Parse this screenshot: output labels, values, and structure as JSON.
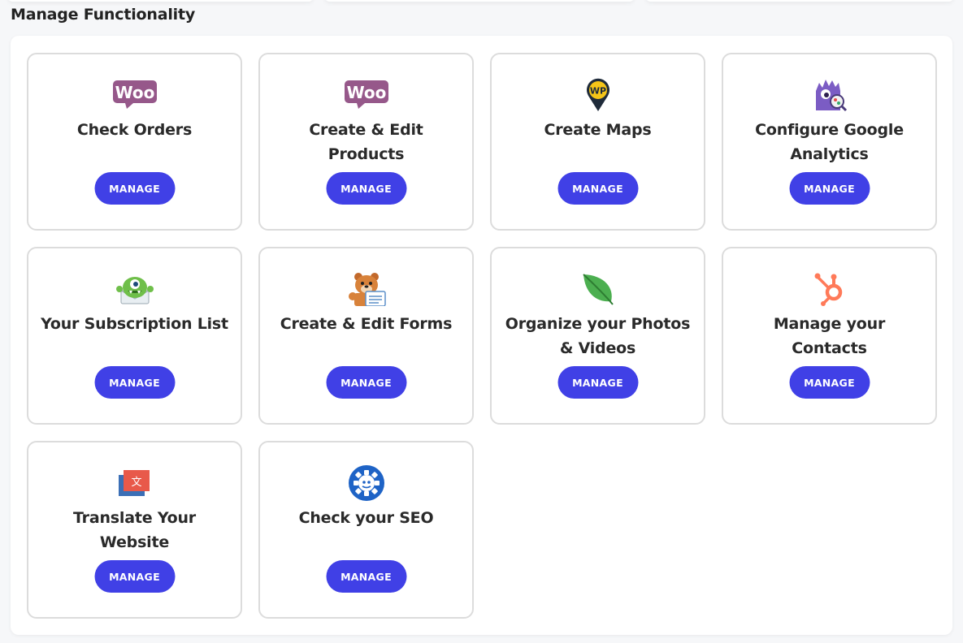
{
  "section": {
    "title": "Manage Functionality"
  },
  "colors": {
    "button": "#4040e6",
    "card_border": "#dcdcdc"
  },
  "cards": [
    {
      "title": "Check Orders",
      "icon": "woocommerce-icon",
      "button": "MANAGE"
    },
    {
      "title": "Create & Edit Products",
      "icon": "woocommerce-icon",
      "button": "MANAGE"
    },
    {
      "title": "Create Maps",
      "icon": "wp-map-pin-icon",
      "button": "MANAGE"
    },
    {
      "title": "Configure Google Analytics",
      "icon": "monsterinsights-icon",
      "button": "MANAGE"
    },
    {
      "title": "Your Subscription List",
      "icon": "optinmonster-icon",
      "button": "MANAGE"
    },
    {
      "title": "Create & Edit Forms",
      "icon": "wpforms-bear-icon",
      "button": "MANAGE"
    },
    {
      "title": "Organize your Photos & Videos",
      "icon": "leaf-icon",
      "button": "MANAGE"
    },
    {
      "title": "Manage your Contacts",
      "icon": "hubspot-icon",
      "button": "MANAGE"
    },
    {
      "title": "Translate Your Website",
      "icon": "translate-icon",
      "button": "MANAGE"
    },
    {
      "title": "Check your SEO",
      "icon": "seo-gear-icon",
      "button": "MANAGE"
    }
  ]
}
